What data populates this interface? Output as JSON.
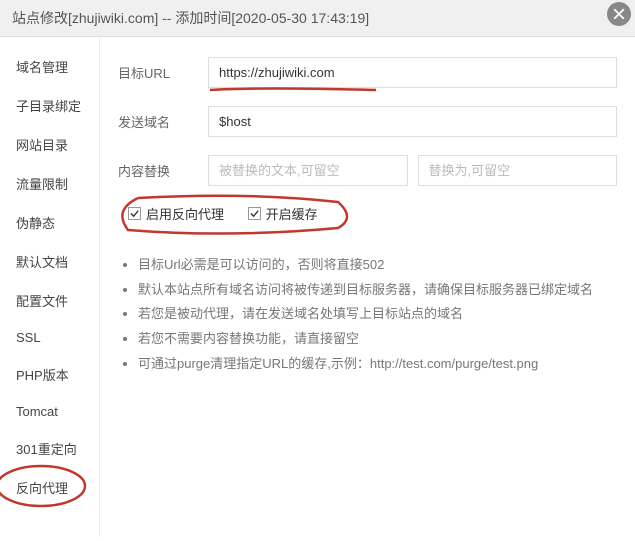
{
  "header": {
    "title": "站点修改[zhujiwiki.com] -- 添加时间[2020-05-30 17:43:19]"
  },
  "sidebar": {
    "items": [
      {
        "label": "域名管理"
      },
      {
        "label": "子目录绑定"
      },
      {
        "label": "网站目录"
      },
      {
        "label": "流量限制"
      },
      {
        "label": "伪静态"
      },
      {
        "label": "默认文档"
      },
      {
        "label": "配置文件"
      },
      {
        "label": "SSL"
      },
      {
        "label": "PHP版本"
      },
      {
        "label": "Tomcat"
      },
      {
        "label": "301重定向"
      },
      {
        "label": "反向代理"
      }
    ]
  },
  "form": {
    "targetUrl": {
      "label": "目标URL",
      "value": "https://zhujiwiki.com"
    },
    "sendDomain": {
      "label": "发送域名",
      "value": "$host"
    },
    "contentReplace": {
      "label": "内容替换",
      "placeholder1": "被替换的文本,可留空",
      "placeholder2": "替换为,可留空"
    },
    "checkbox1": {
      "label": "启用反向代理",
      "checked": true
    },
    "checkbox2": {
      "label": "开启缓存",
      "checked": true
    }
  },
  "notes": [
    "目标Url必需是可以访问的，否则将直接502",
    "默认本站点所有域名访问将被传递到目标服务器，请确保目标服务器已绑定域名",
    "若您是被动代理，请在发送域名处填写上目标站点的域名",
    "若您不需要内容替换功能，请直接留空",
    "可通过purge清理指定URL的缓存,示例：http://test.com/purge/test.png"
  ]
}
